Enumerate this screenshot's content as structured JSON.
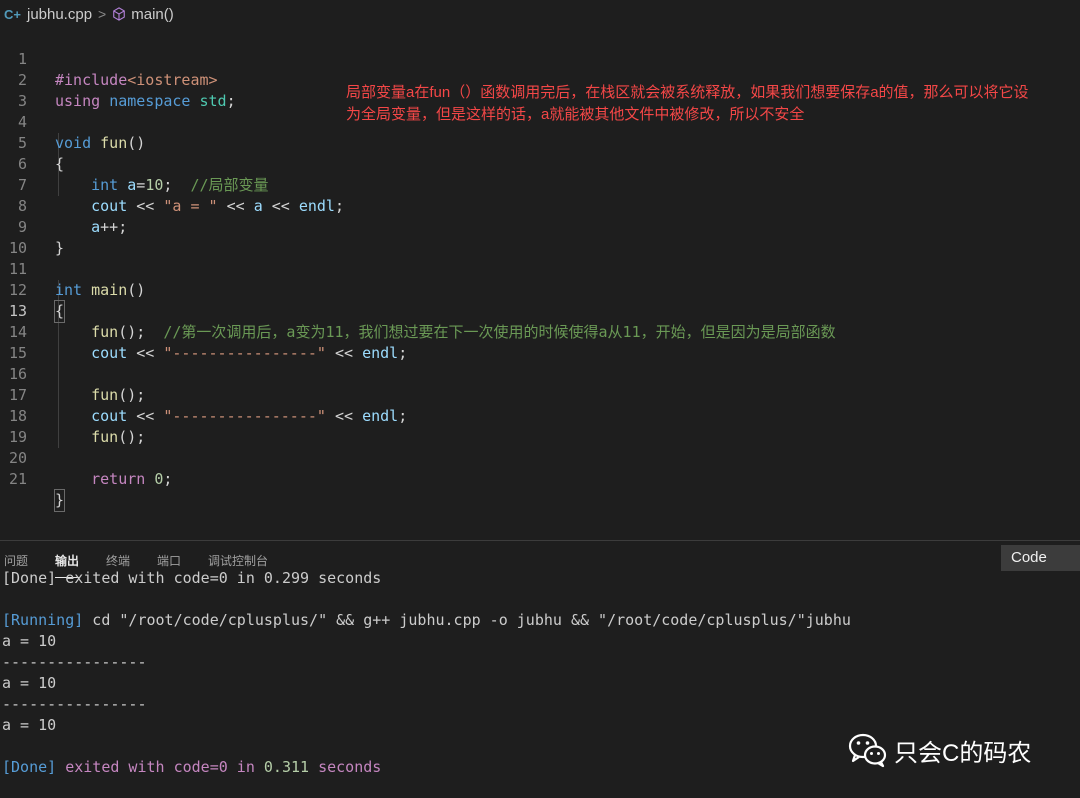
{
  "breadcrumb": {
    "file_icon": "C+",
    "file": "jubhu.cpp",
    "separator": ">",
    "symbol": "main()"
  },
  "editor": {
    "line_numbers": [
      "1",
      "2",
      "3",
      "4",
      "5",
      "6",
      "7",
      "8",
      "9",
      "10",
      "11",
      "12",
      "13",
      "14",
      "15",
      "16",
      "17",
      "18",
      "19",
      "20",
      "21"
    ],
    "active_line": 13,
    "code": {
      "l1_include": "#include",
      "l1_header": "<iostream>",
      "l2_using": "using",
      "l2_namespace": "namespace",
      "l2_std": "std",
      "l2_semi": ";",
      "l4_void": "void",
      "l4_fun": "fun",
      "l4_parens": "()",
      "l5": "{",
      "l6_int": "int",
      "l6_a": "a",
      "l6_eq": "=",
      "l6_10": "10",
      "l6_semi": ";",
      "l6_comment": "//局部变量",
      "l7_cout": "cout",
      "l7_op1": " << ",
      "l7_str": "\"a = \"",
      "l7_op2": " << ",
      "l7_a": "a",
      "l7_op3": " << ",
      "l7_endl": "endl",
      "l7_semi": ";",
      "l8_a": "a",
      "l8_inc": "++;",
      "l9": "}",
      "l11_int": "int",
      "l11_main": "main",
      "l11_parens": "()",
      "l12": "{",
      "l13_fun": "fun",
      "l13_call": "();",
      "l13_comment": "//第一次调用后，a变为11，我们想过要在下一次使用的时候使得a从11，开始，但是因为是局部函数",
      "l14_cout": "cout",
      "l14_op1": " << ",
      "l14_str": "\"----------------\"",
      "l14_op2": " << ",
      "l14_endl": "endl",
      "l14_semi": ";",
      "l16_fun": "fun",
      "l16_call": "();",
      "l17_cout": "cout",
      "l17_op1": " << ",
      "l17_str": "\"----------------\"",
      "l17_op2": " << ",
      "l17_endl": "endl",
      "l17_semi": ";",
      "l18_fun": "fun",
      "l18_call": "();",
      "l20_return": "return",
      "l20_0": "0",
      "l20_semi": ";",
      "l21": "}"
    }
  },
  "annotation": {
    "line1": "局部变量a在fun（）函数调用完后，在栈区就会被系统释放，如果我们想要保存a的值，那么可以将它设",
    "line2": "为全局变量，但是这样的话，a就能被其他文件中被修改，所以不安全"
  },
  "panel": {
    "tabs": [
      "问题",
      "输出",
      "终端",
      "端口",
      "调试控制台"
    ],
    "active_tab": "输出",
    "channel_select": "Code"
  },
  "output": {
    "prev_done": "[Done] exited with code=0 in 0.299 seconds",
    "running_tag": "[Running]",
    "running_cmd": " cd \"/root/code/cplusplus/\" && g++ jubhu.cpp -o jubhu && \"/root/code/cplusplus/\"jubhu",
    "l1": "a = 10",
    "l2": "----------------",
    "l3": "a = 10",
    "l4": "----------------",
    "l5": "a = 10",
    "done_tag": "[Done]",
    "done_text1": " exited with ",
    "done_code": "code=0",
    "done_text2": " in ",
    "done_time": "0.311",
    "done_text3": " seconds"
  },
  "watermark": {
    "icon": "wechat-icon",
    "text": "只会C的码农"
  },
  "colors": {
    "background": "#1e1e1e",
    "annotation": "#f44747",
    "comment": "#6a9955",
    "keyword": "#569cd6"
  }
}
